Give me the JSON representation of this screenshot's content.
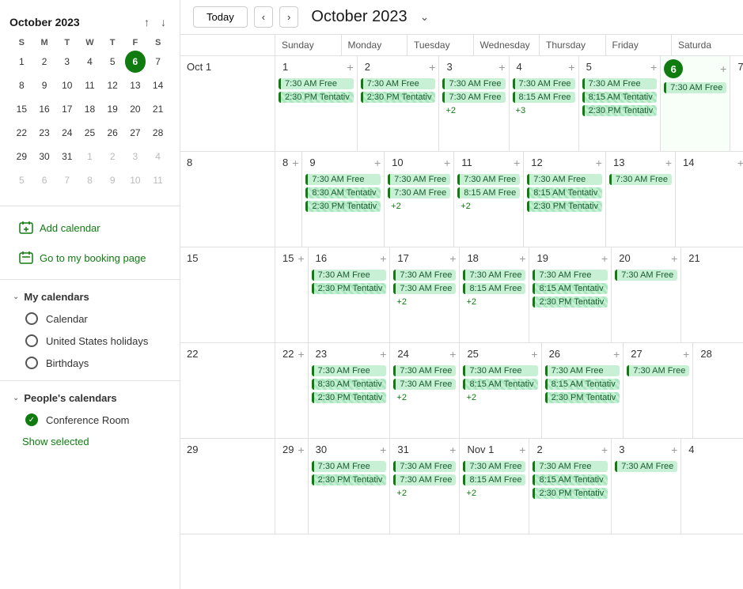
{
  "sidebar": {
    "mini_cal": {
      "title": "October 2023",
      "month": "Oct",
      "year": "2023",
      "days_of_week": [
        "S",
        "M",
        "T",
        "W",
        "T",
        "F",
        "S"
      ],
      "weeks": [
        [
          {
            "day": 1,
            "month": "cur"
          },
          {
            "day": 2,
            "month": "cur"
          },
          {
            "day": 3,
            "month": "cur"
          },
          {
            "day": 4,
            "month": "cur"
          },
          {
            "day": 5,
            "month": "cur"
          },
          {
            "day": 6,
            "month": "cur",
            "today": true
          },
          {
            "day": 7,
            "month": "cur"
          }
        ],
        [
          {
            "day": 8,
            "month": "cur"
          },
          {
            "day": 9,
            "month": "cur"
          },
          {
            "day": 10,
            "month": "cur"
          },
          {
            "day": 11,
            "month": "cur"
          },
          {
            "day": 12,
            "month": "cur"
          },
          {
            "day": 13,
            "month": "cur"
          },
          {
            "day": 14,
            "month": "cur"
          }
        ],
        [
          {
            "day": 15,
            "month": "cur"
          },
          {
            "day": 16,
            "month": "cur"
          },
          {
            "day": 17,
            "month": "cur"
          },
          {
            "day": 18,
            "month": "cur"
          },
          {
            "day": 19,
            "month": "cur"
          },
          {
            "day": 20,
            "month": "cur"
          },
          {
            "day": 21,
            "month": "cur"
          }
        ],
        [
          {
            "day": 22,
            "month": "cur"
          },
          {
            "day": 23,
            "month": "cur"
          },
          {
            "day": 24,
            "month": "cur"
          },
          {
            "day": 25,
            "month": "cur"
          },
          {
            "day": 26,
            "month": "cur"
          },
          {
            "day": 27,
            "month": "cur"
          },
          {
            "day": 28,
            "month": "cur"
          }
        ],
        [
          {
            "day": 29,
            "month": "cur"
          },
          {
            "day": 30,
            "month": "cur"
          },
          {
            "day": 31,
            "month": "cur"
          },
          {
            "day": 1,
            "month": "next"
          },
          {
            "day": 2,
            "month": "next"
          },
          {
            "day": 3,
            "month": "next"
          },
          {
            "day": 4,
            "month": "next"
          }
        ],
        [
          {
            "day": 5,
            "month": "next"
          },
          {
            "day": 6,
            "month": "next"
          },
          {
            "day": 7,
            "month": "next"
          },
          {
            "day": 8,
            "month": "next"
          },
          {
            "day": 9,
            "month": "next"
          },
          {
            "day": 10,
            "month": "next"
          },
          {
            "day": 11,
            "month": "next"
          }
        ]
      ]
    },
    "actions": [
      {
        "label": "Add calendar",
        "icon": "plus-calendar-icon"
      },
      {
        "label": "Go to my booking page",
        "icon": "booking-icon"
      }
    ],
    "my_calendars": {
      "section_title": "My calendars",
      "items": [
        {
          "label": "Calendar",
          "checked": false
        },
        {
          "label": "United States holidays",
          "checked": false
        },
        {
          "label": "Birthdays",
          "checked": false
        }
      ]
    },
    "peoples_calendars": {
      "section_title": "People's calendars",
      "items": [
        {
          "label": "Conference Room",
          "checked": true
        }
      ]
    },
    "show_selected": "Show selected"
  },
  "toolbar": {
    "today_label": "Today",
    "title": "October 2023",
    "nav_prev": "‹",
    "nav_next": "›"
  },
  "calendar": {
    "headers": [
      "Sunday",
      "Monday",
      "Tuesday",
      "Wednesday",
      "Thursday",
      "Friday",
      "Saturda"
    ],
    "weeks": [
      {
        "week_label": "Oct 1",
        "days": [
          {
            "number": "1",
            "label": "Oct 1",
            "today": false,
            "events": [
              {
                "type": "free",
                "text": "7:30 AM Free"
              },
              {
                "type": "tentative",
                "text": "2:30 PM Tentativ"
              }
            ]
          },
          {
            "number": "2",
            "label": "2",
            "today": false,
            "events": [
              {
                "type": "free",
                "text": "7:30 AM Free"
              },
              {
                "type": "tentative",
                "text": "2:30 PM Tentativ"
              }
            ]
          },
          {
            "number": "3",
            "label": "3",
            "today": false,
            "events": [
              {
                "type": "free",
                "text": "7:30 AM Free"
              },
              {
                "type": "free",
                "text": "7:30 AM Free"
              },
              {
                "more": "+2"
              }
            ]
          },
          {
            "number": "4",
            "label": "4",
            "today": false,
            "events": [
              {
                "type": "free",
                "text": "7:30 AM Free"
              },
              {
                "type": "free",
                "text": "8:15 AM Free"
              },
              {
                "more": "+3"
              }
            ]
          },
          {
            "number": "5",
            "label": "5",
            "today": false,
            "events": [
              {
                "type": "free",
                "text": "7:30 AM Free"
              },
              {
                "type": "tentative",
                "text": "8:15 AM Tentativ"
              },
              {
                "type": "tentative",
                "text": "2:30 PM Tentativ"
              }
            ]
          },
          {
            "number": "6",
            "label": "6",
            "today": true,
            "events": [
              {
                "type": "free",
                "text": "7:30 AM Free"
              }
            ]
          },
          {
            "number": "7",
            "label": "7",
            "today": false,
            "events": []
          }
        ]
      },
      {
        "week_label": "8",
        "days": [
          {
            "number": "8",
            "today": false,
            "events": []
          },
          {
            "number": "9",
            "today": false,
            "events": [
              {
                "type": "free",
                "text": "7:30 AM Free"
              },
              {
                "type": "tentative",
                "text": "8:30 AM Tentativ"
              },
              {
                "type": "tentative",
                "text": "2:30 PM Tentativ"
              }
            ]
          },
          {
            "number": "10",
            "today": false,
            "events": [
              {
                "type": "free",
                "text": "7:30 AM Free"
              },
              {
                "type": "free",
                "text": "7:30 AM Free"
              },
              {
                "more": "+2"
              }
            ]
          },
          {
            "number": "11",
            "today": false,
            "events": [
              {
                "type": "free",
                "text": "7:30 AM Free"
              },
              {
                "type": "free",
                "text": "8:15 AM Free"
              },
              {
                "more": "+2"
              }
            ]
          },
          {
            "number": "12",
            "today": false,
            "events": [
              {
                "type": "free",
                "text": "7:30 AM Free"
              },
              {
                "type": "tentative",
                "text": "8:15 AM Tentativ"
              },
              {
                "type": "tentative",
                "text": "2:30 PM Tentativ"
              }
            ]
          },
          {
            "number": "13",
            "today": false,
            "events": [
              {
                "type": "free",
                "text": "7:30 AM Free"
              }
            ]
          },
          {
            "number": "14",
            "today": false,
            "events": []
          }
        ]
      },
      {
        "week_label": "15",
        "days": [
          {
            "number": "15",
            "today": false,
            "events": []
          },
          {
            "number": "16",
            "today": false,
            "events": [
              {
                "type": "free",
                "text": "7:30 AM Free"
              },
              {
                "type": "tentative",
                "text": "2:30 PM Tentativ"
              }
            ]
          },
          {
            "number": "17",
            "today": false,
            "events": [
              {
                "type": "free",
                "text": "7:30 AM Free"
              },
              {
                "type": "free",
                "text": "7:30 AM Free"
              },
              {
                "more": "+2"
              }
            ]
          },
          {
            "number": "18",
            "today": false,
            "events": [
              {
                "type": "free",
                "text": "7:30 AM Free"
              },
              {
                "type": "free",
                "text": "8:15 AM Free"
              },
              {
                "more": "+2"
              }
            ]
          },
          {
            "number": "19",
            "today": false,
            "events": [
              {
                "type": "free",
                "text": "7:30 AM Free"
              },
              {
                "type": "tentative",
                "text": "8:15 AM Tentativ"
              },
              {
                "type": "tentative",
                "text": "2:30 PM Tentativ"
              }
            ]
          },
          {
            "number": "20",
            "today": false,
            "events": [
              {
                "type": "free",
                "text": "7:30 AM Free"
              }
            ]
          },
          {
            "number": "21",
            "today": false,
            "events": []
          }
        ]
      },
      {
        "week_label": "22",
        "days": [
          {
            "number": "22",
            "today": false,
            "events": []
          },
          {
            "number": "23",
            "today": false,
            "events": [
              {
                "type": "free",
                "text": "7:30 AM Free"
              },
              {
                "type": "tentative",
                "text": "8:30 AM Tentativ"
              },
              {
                "type": "tentative",
                "text": "2:30 PM Tentativ"
              }
            ]
          },
          {
            "number": "24",
            "today": false,
            "events": [
              {
                "type": "free",
                "text": "7:30 AM Free"
              },
              {
                "type": "free",
                "text": "7:30 AM Free"
              },
              {
                "more": "+2"
              }
            ]
          },
          {
            "number": "25",
            "today": false,
            "events": [
              {
                "type": "free",
                "text": "7:30 AM Free"
              },
              {
                "type": "tentative",
                "text": "8:15 AM Tentativ"
              },
              {
                "more": "+2"
              }
            ]
          },
          {
            "number": "26",
            "today": false,
            "events": [
              {
                "type": "free",
                "text": "7:30 AM Free"
              },
              {
                "type": "tentative",
                "text": "8:15 AM Tentativ"
              },
              {
                "type": "tentative",
                "text": "2:30 PM Tentativ"
              }
            ]
          },
          {
            "number": "27",
            "today": false,
            "events": [
              {
                "type": "free",
                "text": "7:30 AM Free"
              }
            ]
          },
          {
            "number": "28",
            "today": false,
            "events": []
          }
        ]
      },
      {
        "week_label": "29",
        "days": [
          {
            "number": "29",
            "today": false,
            "events": []
          },
          {
            "number": "30",
            "today": false,
            "events": [
              {
                "type": "free",
                "text": "7:30 AM Free"
              },
              {
                "type": "tentative",
                "text": "2:30 PM Tentativ"
              }
            ]
          },
          {
            "number": "31",
            "today": false,
            "events": [
              {
                "type": "free",
                "text": "7:30 AM Free"
              },
              {
                "type": "free",
                "text": "7:30 AM Free"
              },
              {
                "more": "+2"
              }
            ]
          },
          {
            "number": "Nov 1",
            "today": false,
            "events": [
              {
                "type": "free",
                "text": "7:30 AM Free"
              },
              {
                "type": "free",
                "text": "8:15 AM Free"
              },
              {
                "more": "+2"
              }
            ]
          },
          {
            "number": "2",
            "today": false,
            "events": [
              {
                "type": "free",
                "text": "7:30 AM Free"
              },
              {
                "type": "tentative",
                "text": "8:15 AM Tentativ"
              },
              {
                "type": "tentative",
                "text": "2:30 PM Tentativ"
              }
            ]
          },
          {
            "number": "3",
            "today": false,
            "events": [
              {
                "type": "free",
                "text": "7:30 AM Free"
              }
            ]
          },
          {
            "number": "4",
            "today": false,
            "events": []
          }
        ]
      }
    ]
  }
}
